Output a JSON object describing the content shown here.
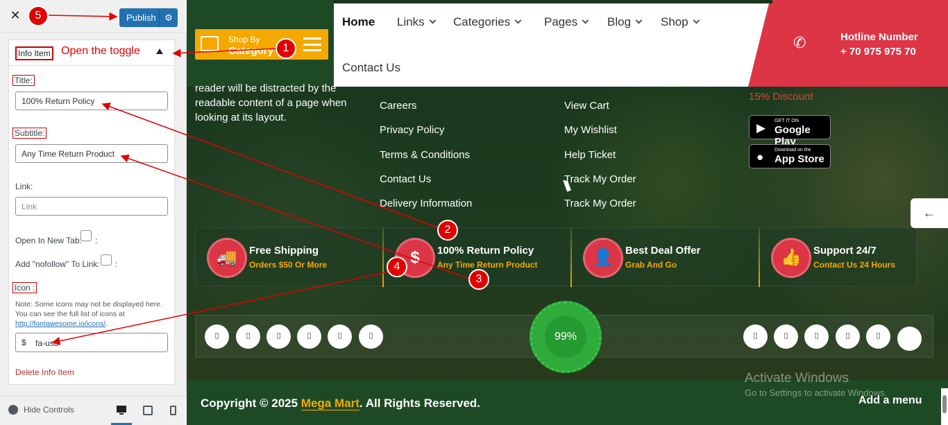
{
  "panel": {
    "publish_label": "Publish",
    "section_title": "Info Item",
    "fields": {
      "title_label": "Title:",
      "title_value": "100% Return Policy",
      "subtitle_label": "Subtitle:",
      "subtitle_value": "Any Time Return Product",
      "link_label": "Link:",
      "link_placeholder": "Link",
      "new_tab_label": "Open In New Tab:",
      "new_tab_suffix": ":",
      "nofollow_label": "Add \"nofollow\" To Link:",
      "nofollow_suffix": ":",
      "icon_label": "Icon :",
      "icon_note": "Note: Some icons may not be displayed here. You can see the full list of icons at",
      "icon_note_link": "http://fontawesome.io/icons/",
      "icon_note_end": ".",
      "icon_symbol": "$",
      "icon_value": "fa-usd"
    },
    "delete_label": "Delete Info Item",
    "hide_controls_label": "Hide Controls"
  },
  "annotations": {
    "toggle_note": "Open the toggle",
    "steps": [
      "1",
      "2",
      "3",
      "4",
      "5"
    ]
  },
  "site": {
    "shop_by_line1": "Shop By",
    "shop_by_line2": "Category",
    "nav": [
      "Home",
      "Links",
      "Categories",
      "Pages",
      "Blog",
      "Shop"
    ],
    "nav_contact": "Contact Us",
    "hotline_title": "Hotline Number",
    "hotline_number": "+ 70 975 975 70",
    "footer_desc": "reader will be distracted by the readable content of a page when looking at its layout.",
    "links_col1": [
      "Careers",
      "Privacy Policy",
      "Terms & Conditions",
      "Contact Us",
      "Delivery Information"
    ],
    "links_col2": [
      "View Cart",
      "My Wishlist",
      "Help Ticket",
      "Track My Order",
      "Track My Order"
    ],
    "discount": "15% Discount",
    "google_play_small": "GET IT ON",
    "google_play": "Google Play",
    "app_store_small": "Download on the",
    "app_store": "App Store",
    "features": [
      {
        "title": "Free Shipping",
        "sub": "Orders $50 Or More",
        "glyph": "🚚"
      },
      {
        "title": "100% Return Policy",
        "sub": "Any Time Return Product",
        "glyph": "$"
      },
      {
        "title": "Best Deal Offer",
        "sub": "Grab And Go",
        "glyph": "👤"
      },
      {
        "title": "Support 24/7",
        "sub": "Contact Us 24 Hours",
        "glyph": "👍"
      }
    ],
    "social_glyph": "▯",
    "badge": "99%",
    "copyright_prefix": "Copyright © 2025 ",
    "copyright_brand": "Mega Mart",
    "copyright_suffix": ". All Rights Reserved.",
    "add_menu": "Add a menu",
    "activate_title": "Activate Windows",
    "activate_sub": "Go to Settings to activate Windows.",
    "side_arrow": "←"
  },
  "colors": {
    "accent_red": "#dc3545",
    "accent_orange": "#f5a800",
    "footer_green": "#1d4a25",
    "publish_blue": "#2271b1",
    "annotation_red": "#e00000"
  }
}
